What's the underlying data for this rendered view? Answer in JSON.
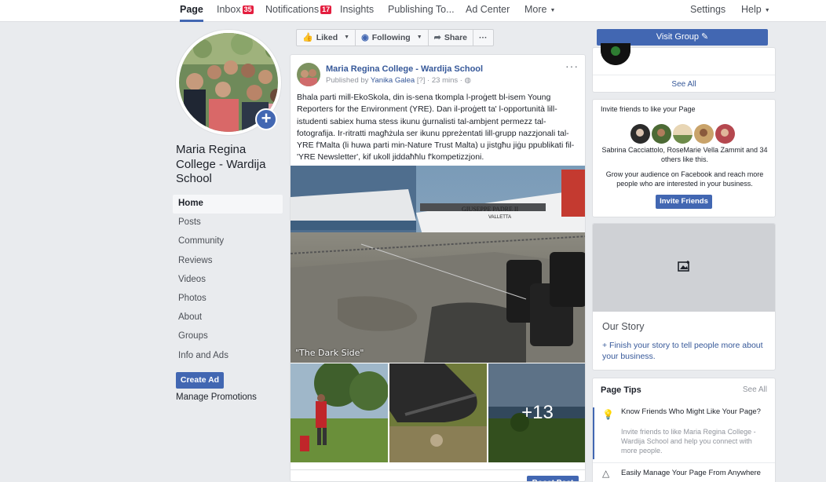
{
  "topnav": {
    "page": "Page",
    "inbox": "Inbox",
    "inbox_count": "35",
    "notifications": "Notifications",
    "notifications_count": "17",
    "insights": "Insights",
    "publishing": "Publishing To...",
    "ad_center": "Ad Center",
    "more": "More",
    "settings": "Settings",
    "help": "Help"
  },
  "left": {
    "page_name": "Maria Regina College - Wardija School",
    "nav": [
      "Home",
      "Posts",
      "Community",
      "Reviews",
      "Videos",
      "Photos",
      "About",
      "Groups",
      "Info and Ads"
    ],
    "create_ad": "Create Ad",
    "manage_promotions": "Manage Promotions"
  },
  "actions": {
    "liked": "Liked",
    "following": "Following",
    "share": "Share",
    "more": "···"
  },
  "post": {
    "author": "Maria Regina College - Wardija School",
    "published_by": "Published by",
    "publisher": "Yanika Galea",
    "qmark": "[?]",
    "time": "23 mins",
    "more": "···",
    "text": "Bhala parti mill-EkoSkola, din is-sena tkompla l-proġett bl-isem Young Reporters for the Environment (YRE). Dan il-proġett ta' l-opportunità lill-istudenti sabiex huma stess ikunu ġurnalisti tal-ambjent permezz tal-fotografija. Ir-ritratti magħżula ser ikunu ppreżentati lill-grupp nazzjonali tal-YRE f'Malta (li huwa parti min-Nature Trust Malta) u jistgħu jiġu ppublikati fil-'YRE Newsletter', kif ukoll jiddaħħlu f'kompetizzjoni.",
    "image_caption": "\"The Dark Side\"",
    "boat_name": "GIUSEPPE PADRE II",
    "boat_port": "VALLETTA",
    "more_photos": "+13",
    "boost": "Boost Post"
  },
  "right": {
    "visit_group": "Visit Group",
    "see_all": "See All",
    "invite_header": "Invite friends to like your Page",
    "likers": "Sabrina Cacciattolo, RoseMarie Vella Zammit and 34 others like this.",
    "grow": "Grow your audience on Facebook and reach more people who are interested in your business.",
    "invite_button": "Invite Friends",
    "story_title": "Our Story",
    "story_link": "+ Finish your story to tell people more about your business.",
    "tips_title": "Page Tips",
    "tips_see_all": "See All",
    "tips": [
      {
        "title": "Know Friends Who Might Like Your Page?",
        "desc": "Invite friends to like Maria Regina College - Wardija School and help you connect with more people."
      },
      {
        "title": "Easily Manage Your Page From Anywhere",
        "desc": ""
      }
    ]
  },
  "colors": {
    "brand": "#4267b2",
    "link": "#365899",
    "badge": "#e41e3f",
    "background": "#e9ebee"
  }
}
